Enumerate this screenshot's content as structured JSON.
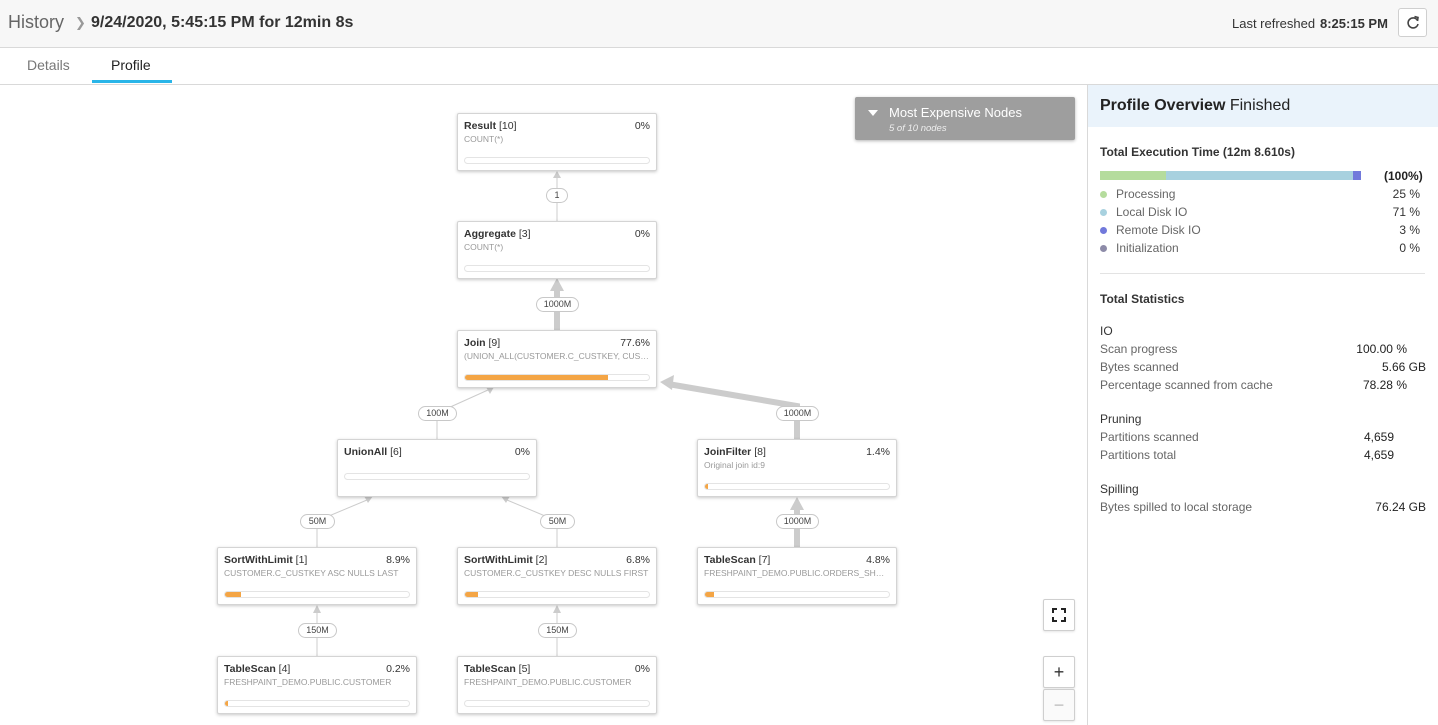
{
  "header": {
    "breadcrumb": "History",
    "title": "9/24/2020, 5:45:15 PM for 12min 8s",
    "last_refreshed_label": "Last refreshed",
    "last_refreshed_time": "8:25:15 PM"
  },
  "tabs": [
    {
      "label": "Details",
      "active": false
    },
    {
      "label": "Profile",
      "active": true
    }
  ],
  "most_expensive": {
    "title": "Most Expensive Nodes",
    "subtitle": "5 of 10 nodes"
  },
  "nodes": {
    "result": {
      "name": "Result",
      "id": "[10]",
      "pct": "0%",
      "detail": "COUNT(*)",
      "progress": 0
    },
    "aggregate": {
      "name": "Aggregate",
      "id": "[3]",
      "pct": "0%",
      "detail": "COUNT(*)",
      "progress": 0
    },
    "join": {
      "name": "Join",
      "id": "[9]",
      "pct": "77.6%",
      "detail": "(UNION_ALL(CUSTOMER.C_CUSTKEY, CUSTOMER.C_CUSTKEY))",
      "progress": 0.776
    },
    "unionall": {
      "name": "UnionAll",
      "id": "[6]",
      "pct": "0%",
      "detail": "",
      "progress": 0
    },
    "joinfilter": {
      "name": "JoinFilter",
      "id": "[8]",
      "pct": "1.4%",
      "detail": "Original join id:9",
      "progress": 0.014
    },
    "sort1": {
      "name": "SortWithLimit",
      "id": "[1]",
      "pct": "8.9%",
      "detail": "CUSTOMER.C_CUSTKEY ASC NULLS LAST",
      "progress": 0.089
    },
    "sort2": {
      "name": "SortWithLimit",
      "id": "[2]",
      "pct": "6.8%",
      "detail": "CUSTOMER.C_CUSTKEY DESC NULLS FIRST",
      "progress": 0.068
    },
    "scan7": {
      "name": "TableScan",
      "id": "[7]",
      "pct": "4.8%",
      "detail": "FRESHPAINT_DEMO.PUBLIC.ORDERS_SHUFFLED",
      "progress": 0.048
    },
    "scan4": {
      "name": "TableScan",
      "id": "[4]",
      "pct": "0.2%",
      "detail": "FRESHPAINT_DEMO.PUBLIC.CUSTOMER",
      "progress": 0.002
    },
    "scan5": {
      "name": "TableScan",
      "id": "[5]",
      "pct": "0%",
      "detail": "FRESHPAINT_DEMO.PUBLIC.CUSTOMER",
      "progress": 0
    }
  },
  "edges": {
    "agg_result": "1",
    "join_agg": "1000M",
    "union_join": "100M",
    "jf_join": "1000M",
    "sort1_union": "50M",
    "sort2_union": "50M",
    "scan7_jf": "1000M",
    "scan4_sort1": "150M",
    "scan5_sort2": "150M"
  },
  "panel": {
    "title": "Profile Overview",
    "status": "Finished",
    "exec_title": "Total Execution Time (12m 8.610s)",
    "exec_pct": "(100%)",
    "breakdown": [
      {
        "name": "Processing",
        "value": "25 %",
        "fraction": 0.25,
        "color": "#b5dc9d"
      },
      {
        "name": "Local Disk IO",
        "value": "71 %",
        "fraction": 0.71,
        "color": "#a8d1df"
      },
      {
        "name": "Remote Disk IO",
        "value": "3 %",
        "fraction": 0.03,
        "color": "#7179db"
      },
      {
        "name": "Initialization",
        "value": "0 %",
        "fraction": 0.0,
        "color": "#8d8ba8"
      }
    ],
    "stats_title": "Total Statistics",
    "io": {
      "title": "IO",
      "rows": [
        {
          "name": "Scan progress",
          "value": "100.00 %"
        },
        {
          "name": "Bytes scanned",
          "value": "5.66 GB"
        },
        {
          "name": "Percentage scanned from cache",
          "value": "78.28 %"
        }
      ]
    },
    "pruning": {
      "title": "Pruning",
      "rows": [
        {
          "name": "Partitions scanned",
          "value": "4,659"
        },
        {
          "name": "Partitions total",
          "value": "4,659"
        }
      ]
    },
    "spilling": {
      "title": "Spilling",
      "rows": [
        {
          "name": "Bytes spilled to local storage",
          "value": "76.24 GB"
        }
      ]
    }
  },
  "icons": {
    "refresh": "refresh-icon",
    "fit": "fit-screen-icon",
    "zoom_in": "+",
    "zoom_out": "−",
    "dropdown": "triangle-down-icon"
  }
}
